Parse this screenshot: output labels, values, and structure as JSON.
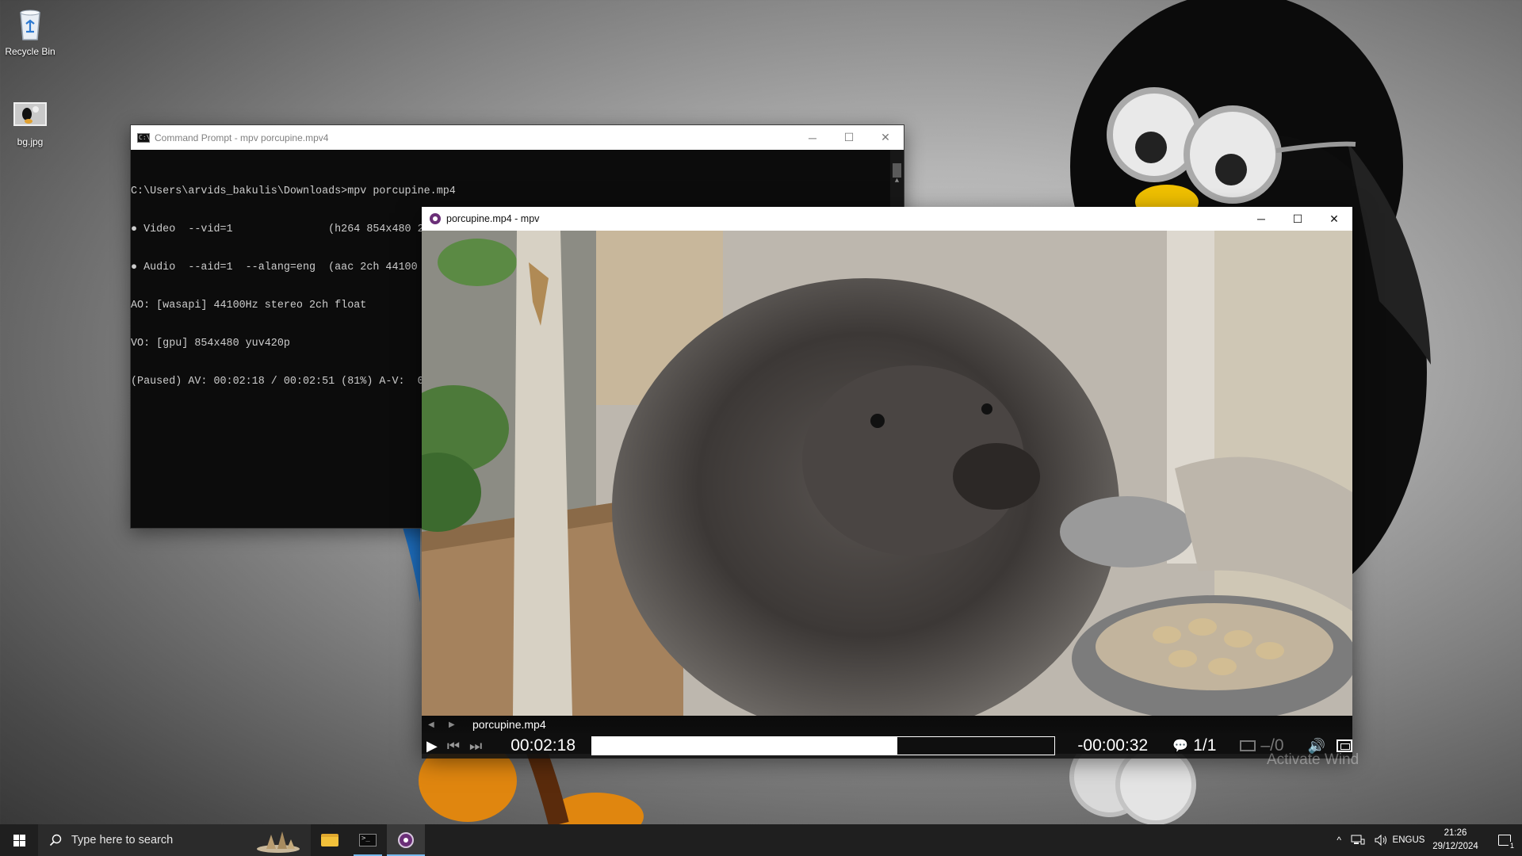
{
  "desktop": {
    "icons": [
      {
        "label": "Recycle Bin",
        "icon": "recycle-bin-icon"
      },
      {
        "label": "bg.jpg",
        "icon": "image-file-icon"
      }
    ],
    "watermark": "Activate Wind"
  },
  "cmd_window": {
    "title": "Command Prompt - mpv  porcupine.mpv4",
    "lines": [
      "C:\\Users\\arvids_bakulis\\Downloads>mpv porcupine.mp4",
      "● Video  --vid=1               (h264 854x480 29.97 fps) [default]",
      "● Audio  --aid=1  --alang=eng  (aac 2ch 44100 Hz 128 kbps) [default]",
      "AO: [wasapi] 44100Hz stereo 2ch float",
      "VO: [gpu] 854x480 yuv420p",
      "(Paused) AV: 00:02:18 / 00:02:51 (81%) A-V:  0"
    ],
    "controls": {
      "minimize": "─",
      "maximize": "☐",
      "close": "✕"
    }
  },
  "mpv_window": {
    "title": "porcupine.mp4 - mpv",
    "controls": {
      "minimize": "─",
      "maximize": "☐",
      "close": "✕"
    },
    "osc": {
      "filename": "porcupine.mp4",
      "prev_arrow": "◀",
      "next_arrow": "▶",
      "play_icon": "▶",
      "skip_back_icon": "⏮",
      "skip_fwd_icon": "⏭",
      "current_time": "00:02:18",
      "remaining_time": "-00:00:32",
      "progress_fraction": 0.66,
      "chapter_count": "1/1",
      "subtitle_track": "–/0",
      "volume_icon": "🔊",
      "bubble_icon": "💬"
    }
  },
  "taskbar": {
    "search_placeholder": "Type here to search",
    "apps": [
      {
        "name": "file-explorer",
        "state": "idle"
      },
      {
        "name": "command-prompt",
        "state": "running"
      },
      {
        "name": "mpv",
        "state": "active"
      }
    ],
    "tray": {
      "lang_top": "ENG",
      "lang_bottom": "US",
      "time": "21:26",
      "date": "29/12/2024",
      "notifications": "1"
    }
  },
  "colors": {
    "taskbar_bg": "#1f1f1f",
    "accent": "#76b9ed",
    "mpv_brand": "#6b2f78",
    "console_bg": "#0c0c0c"
  }
}
